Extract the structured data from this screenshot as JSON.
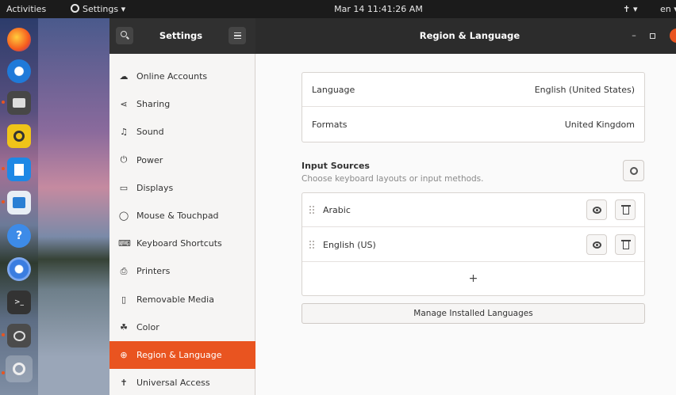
{
  "topbar": {
    "activities": "Activities",
    "app_menu": "Settings ▾",
    "clock": "Mar 14  11:41:26 AM",
    "accessibility": "✝ ▾",
    "lang": "en ▾"
  },
  "dock": {
    "items": [
      {
        "icon": "firefox-icon"
      },
      {
        "icon": "thunderbird-icon"
      },
      {
        "icon": "files-icon"
      },
      {
        "icon": "rhythmbox-icon"
      },
      {
        "icon": "writer-icon"
      },
      {
        "icon": "software-icon"
      },
      {
        "icon": "help-icon"
      },
      {
        "icon": "chromium-icon"
      },
      {
        "icon": "terminal-icon"
      },
      {
        "icon": "chat-icon"
      },
      {
        "icon": "settings-icon"
      }
    ]
  },
  "sidebar": {
    "title": "Settings",
    "items": [
      {
        "label": "Online Accounts",
        "icon": "cloud-icon",
        "glyph": "☁"
      },
      {
        "label": "Sharing",
        "icon": "share-icon",
        "glyph": "⋖"
      },
      {
        "label": "Sound",
        "icon": "music-note-icon",
        "glyph": "♫"
      },
      {
        "label": "Power",
        "icon": "power-icon",
        "glyph": "⏻"
      },
      {
        "label": "Displays",
        "icon": "display-icon",
        "glyph": "▭"
      },
      {
        "label": "Mouse & Touchpad",
        "icon": "mouse-icon",
        "glyph": "◯"
      },
      {
        "label": "Keyboard Shortcuts",
        "icon": "keyboard-icon",
        "glyph": "⌨"
      },
      {
        "label": "Printers",
        "icon": "printer-icon",
        "glyph": "⎙"
      },
      {
        "label": "Removable Media",
        "icon": "removable-media-icon",
        "glyph": "▯"
      },
      {
        "label": "Color",
        "icon": "color-icon",
        "glyph": "☘"
      },
      {
        "label": "Region & Language",
        "icon": "globe-icon",
        "glyph": "⊕",
        "active": true
      },
      {
        "label": "Universal Access",
        "icon": "accessibility-icon",
        "glyph": "✝"
      }
    ]
  },
  "main": {
    "title": "Region & Language",
    "language_label": "Language",
    "language_value": "English (United States)",
    "formats_label": "Formats",
    "formats_value": "United Kingdom",
    "input_sources_title": "Input Sources",
    "input_sources_subtitle": "Choose keyboard layouts or input methods.",
    "sources": [
      "Arabic",
      "English (US)"
    ],
    "add_label": "+",
    "manage_label": "Manage Installed Languages"
  },
  "colors": {
    "accent": "#e95420",
    "header": "#2c2c2c"
  }
}
